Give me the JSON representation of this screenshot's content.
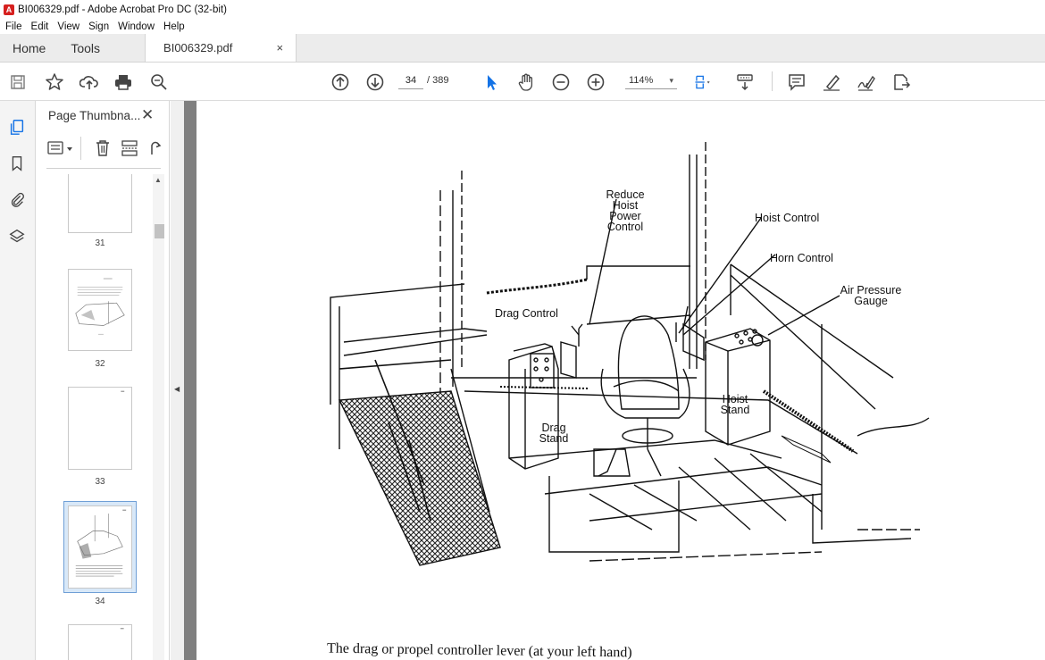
{
  "window": {
    "title": "BI006329.pdf - Adobe Acrobat Pro DC (32-bit)",
    "app_icon": "acrobat-icon"
  },
  "menu": [
    "File",
    "Edit",
    "View",
    "Sign",
    "Window",
    "Help"
  ],
  "tabs": {
    "home": "Home",
    "tools": "Tools",
    "document": "BI006329.pdf",
    "close": "×"
  },
  "toolbar": {
    "page_current": "34",
    "page_total": "/ 389",
    "zoom": "114%",
    "zoom_caret": "▾",
    "icons_left": [
      "save-icon",
      "bookmark-star-icon",
      "upload-cloud-icon",
      "print-icon",
      "zoom-search-icon"
    ],
    "icons_center": [
      "page-up-icon",
      "page-down-icon",
      "select-cursor-icon",
      "hand-tool-icon",
      "zoom-out-icon",
      "zoom-in-icon",
      "fit-page-icon",
      "scroll-mode-icon"
    ],
    "icons_right": [
      "comment-icon",
      "highlight-pen-icon",
      "sign-icon",
      "share-icon"
    ]
  },
  "navrail": {
    "icons": [
      "page-thumbnails-icon",
      "bookmarks-icon",
      "attachments-icon",
      "layers-icon"
    ]
  },
  "thumbnails_panel": {
    "title": "Page Thumbna...",
    "close": "✕",
    "tools": [
      "options-menu-icon",
      "delete-page-icon",
      "extract-page-icon",
      "rotate-page-icon"
    ],
    "pages": [
      {
        "label": "31",
        "selected": false
      },
      {
        "label": "32",
        "selected": false
      },
      {
        "label": "33",
        "selected": false
      },
      {
        "label": "34",
        "selected": true
      },
      {
        "label": "",
        "selected": false
      }
    ]
  },
  "document": {
    "labels": {
      "reduce_hoist": "Reduce Hoist Power Control",
      "reduce_hoist_lines": [
        "Reduce",
        "Hoist",
        "Power",
        "Control"
      ],
      "hoist_control": "Hoist Control",
      "horn_control": "Horn Control",
      "air_pressure_lines": [
        "Air Pressure",
        "Gauge"
      ],
      "drag_control": "Drag Control",
      "hoist_stand_lines": [
        "Hoist",
        "Stand"
      ],
      "drag_stand_lines": [
        "Drag",
        "Stand"
      ]
    },
    "body_text": "The drag or propel controller lever (at your left hand)"
  },
  "colors": {
    "accent": "#d6201f",
    "selected_thumb": "#d8e8f8",
    "doc_background": "#808080"
  }
}
